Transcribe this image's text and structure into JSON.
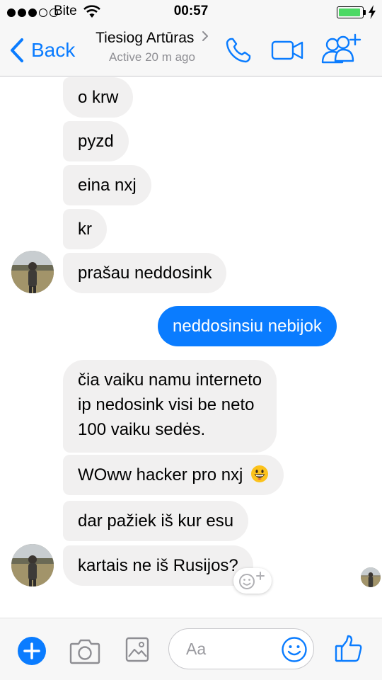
{
  "status_bar": {
    "carrier": "Bite",
    "time": "00:57",
    "signal_bars": 3,
    "signal_total": 5,
    "battery_level": 0.95,
    "battery_color": "#4cd964",
    "icons": [
      "wifi-icon",
      "battery-icon",
      "charging-bolt-icon"
    ]
  },
  "nav": {
    "back_label": "Back",
    "contact_name": "Tiesiog Artūras",
    "contact_status": "Active 20 m ago",
    "icons": [
      "back-chevron-icon",
      "chevron-right-icon",
      "phone-icon",
      "video-camera-icon",
      "add-people-icon"
    ],
    "accent_color": "#0a7cff"
  },
  "messages": [
    {
      "id": "m1",
      "direction": "in",
      "text": "o krw"
    },
    {
      "id": "m2",
      "direction": "in",
      "text": "pyzd"
    },
    {
      "id": "m3",
      "direction": "in",
      "text": "eina nxj"
    },
    {
      "id": "m4",
      "direction": "in",
      "text": "kr"
    },
    {
      "id": "m5",
      "direction": "in",
      "text": "prašau neddosink"
    },
    {
      "id": "m6",
      "direction": "out",
      "text": "neddosinsiu nebijok"
    },
    {
      "id": "m7",
      "direction": "in",
      "lines": [
        "čia vaiku namu interneto",
        "ip nedosink visi be neto",
        "100 vaiku sedės."
      ]
    },
    {
      "id": "m8",
      "direction": "in",
      "text": "WOww hacker pro nxj",
      "emoji_icon": "grinning-face-icon"
    },
    {
      "id": "m9",
      "direction": "in",
      "text": "dar pažiek iš kur esu"
    },
    {
      "id": "m10",
      "direction": "in",
      "text": "kartais ne iš Rusijos?"
    }
  ],
  "reaction_button_icon": "add-reaction-icon",
  "composer": {
    "placeholder": "Aa",
    "icons": [
      "plus-icon",
      "camera-icon",
      "gallery-icon",
      "emoji-icon",
      "thumbs-up-icon"
    ]
  },
  "colors": {
    "bubble_in": "#f1f0f0",
    "bubble_out": "#0a7cff",
    "bar_background": "#f7f7f7"
  }
}
